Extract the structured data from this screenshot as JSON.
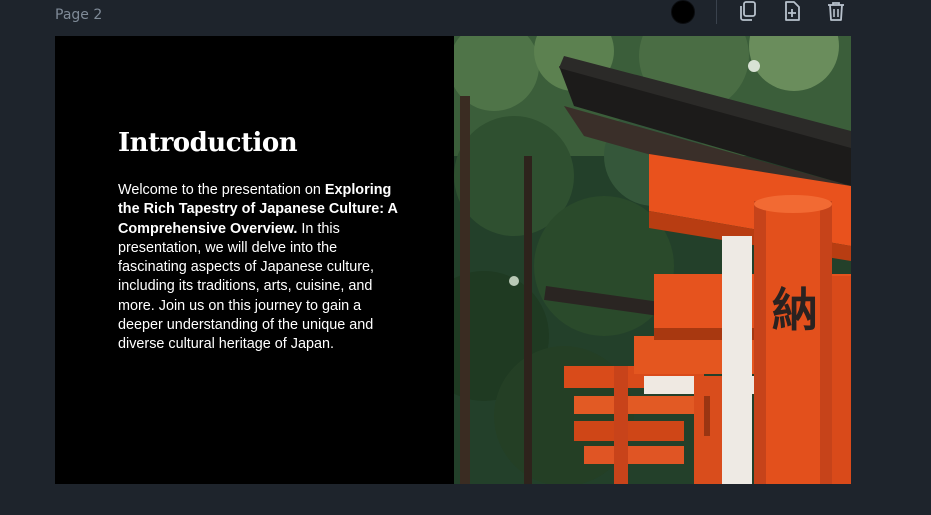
{
  "editor": {
    "page_label": "Page 2",
    "page_color": "#000000",
    "toolbar": {
      "icons": [
        "color-swatch-icon",
        "duplicate-icon",
        "add-page-icon",
        "trash-icon"
      ]
    }
  },
  "slide": {
    "title": "Introduction",
    "body": {
      "intro": "Welcome to the presentation on ",
      "bold": "Exploring the Rich Tapestry of Japanese Culture: A Comprehensive Overview.",
      "rest": " In this presentation, we will delve into the fascinating aspects of Japanese culture, including its traditions, arts, cuisine, and more. Join us on this journey to gain a deeper understanding of the unique and diverse cultural heritage of Japan."
    },
    "image": {
      "subject": "torii-gates-photo",
      "kanji": "納"
    },
    "colors": {
      "background": "#000000",
      "text": "#ffffff",
      "torii_orange": "#e8511e",
      "foliage": "#2d4a2c"
    }
  }
}
